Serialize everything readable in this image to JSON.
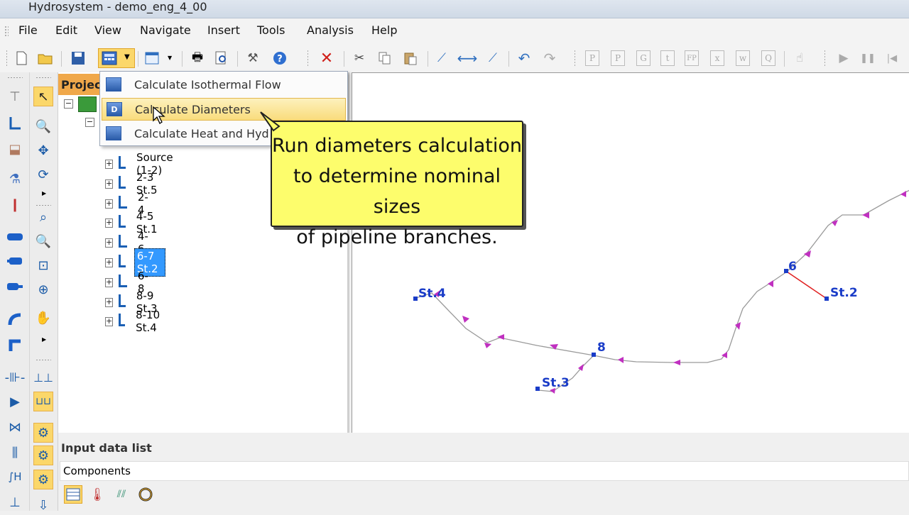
{
  "window": {
    "title": "Hydrosystem - demo_eng_4_00"
  },
  "menu": [
    "File",
    "Edit",
    "View",
    "Navigate",
    "Insert",
    "Tools",
    "Analysis",
    "Help"
  ],
  "toolbar": {
    "letter_buttons": [
      "P",
      "P",
      "G",
      "t",
      "FP",
      "x",
      "w",
      "Q"
    ]
  },
  "dropdown": {
    "items": [
      {
        "label": "Calculate Isothermal Flow",
        "icon_text": ""
      },
      {
        "label": "Calculate Diameters",
        "icon_text": "D"
      },
      {
        "label": "Calculate Heat and Hyd",
        "icon_text": ""
      }
    ]
  },
  "project_panel": {
    "header": "Projec",
    "items": [
      "Source (1-2)",
      "2-3 St.5",
      "2-4",
      "4-5 St.1",
      "4-6",
      "6-7 St.2",
      "6-8",
      "8-9 St.3",
      "8-10 St.4"
    ],
    "selected": "6-7 St.2"
  },
  "callout": {
    "lines": [
      "Run diameters calculation",
      "to determine nominal sizes",
      "of pipeline branches."
    ]
  },
  "canvas": {
    "labels": [
      "St.4",
      "8",
      "St.3",
      "6",
      "St.2"
    ]
  },
  "input_panel": {
    "title": "Input data list",
    "tab": "Components"
  },
  "colors": {
    "accent": "#fbd76a",
    "selection": "#3399ff",
    "callout": "#fdfd6c",
    "node": "#1a3cc8",
    "arrow": "#c030c0"
  }
}
